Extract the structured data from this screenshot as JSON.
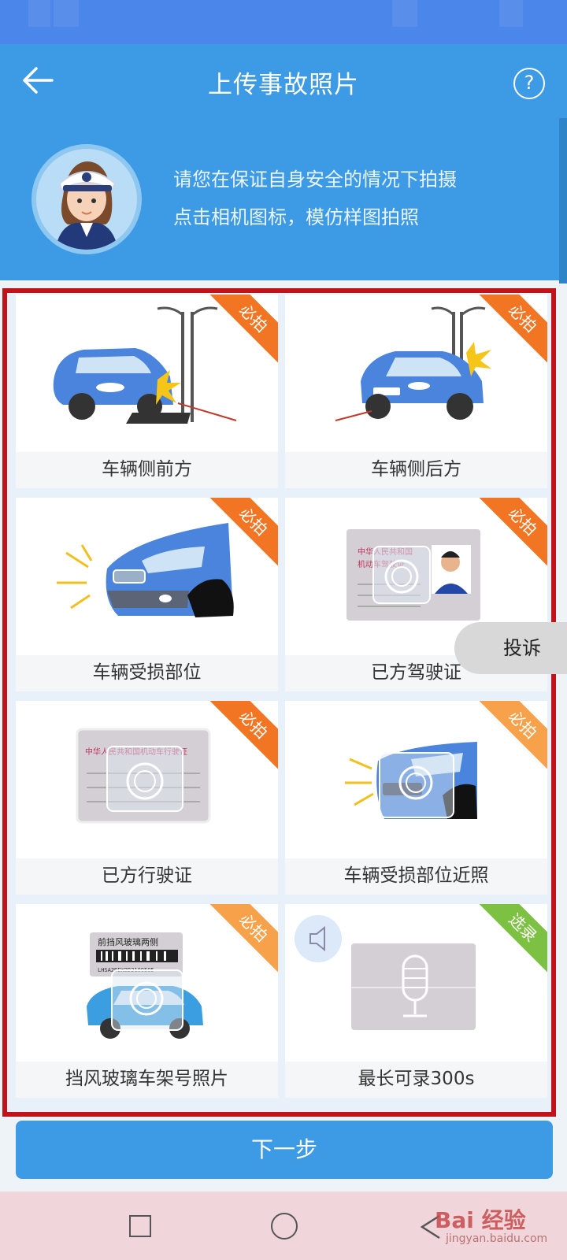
{
  "header": {
    "title": "上传事故照片",
    "help_label": "?",
    "tip_lines": [
      "请您在保证自身安全的情况下拍摄",
      "点击相机图标，模仿样图拍照"
    ]
  },
  "cards": [
    {
      "label": "车辆侧前方",
      "badge": "必拍"
    },
    {
      "label": "车辆侧后方",
      "badge": "必拍"
    },
    {
      "label": "车辆受损部位",
      "badge": "必拍"
    },
    {
      "label": "已方驾驶证",
      "badge": "必拍",
      "card_text": [
        "中华人民共和国",
        "机动车驾驶证"
      ]
    },
    {
      "label": "已方行驶证",
      "badge": "必拍",
      "card_text": [
        "中华人民共和国机动车行驶证"
      ]
    },
    {
      "label": "车辆受损部位近照",
      "badge": "必拍"
    },
    {
      "label": "挡风玻璃车架号照片",
      "badge": "必拍",
      "plate_title": "前挡风玻璃两侧",
      "vin": "LHSA2DEW2D2100505"
    },
    {
      "label": "最长可录300s",
      "badge": "选录"
    }
  ],
  "complain_label": "投诉",
  "next_label": "下一步",
  "watermark": {
    "brand": "Bai 经验",
    "url": "jingyan.baidu.com"
  },
  "colors": {
    "primary": "#3d9ae5",
    "status_bar": "#4b86ea",
    "badge_orange": "#f27523",
    "badge_green": "#7cc142",
    "frame_red": "#c0141a"
  }
}
